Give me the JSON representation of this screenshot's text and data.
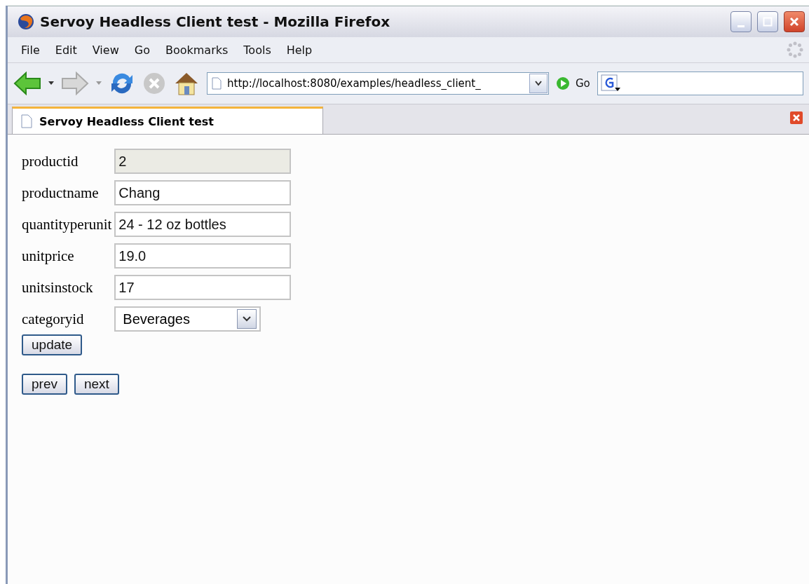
{
  "window": {
    "title": "Servoy Headless Client test - Mozilla Firefox"
  },
  "menu": [
    "File",
    "Edit",
    "View",
    "Go",
    "Bookmarks",
    "Tools",
    "Help"
  ],
  "toolbar": {
    "address": "http://localhost:8080/examples/headless_client_",
    "go": "Go"
  },
  "tabs": [
    {
      "label": "Servoy Headless Client test",
      "selected": true
    }
  ],
  "form": {
    "fields": [
      {
        "label": "productid",
        "kind": "text",
        "value": "2",
        "disabled": true
      },
      {
        "label": "productname",
        "kind": "text",
        "value": "Chang",
        "disabled": false
      },
      {
        "label": "quantityperunit",
        "kind": "text",
        "value": "24 - 12 oz bottles",
        "disabled": false
      },
      {
        "label": "unitprice",
        "kind": "text",
        "value": "19.0",
        "disabled": false
      },
      {
        "label": "unitsinstock",
        "kind": "text",
        "value": "17",
        "disabled": false
      },
      {
        "label": "categoryid",
        "kind": "select",
        "value": "Beverages",
        "disabled": false
      }
    ],
    "update_button": "update",
    "nav_buttons": [
      "prev",
      "next"
    ]
  }
}
